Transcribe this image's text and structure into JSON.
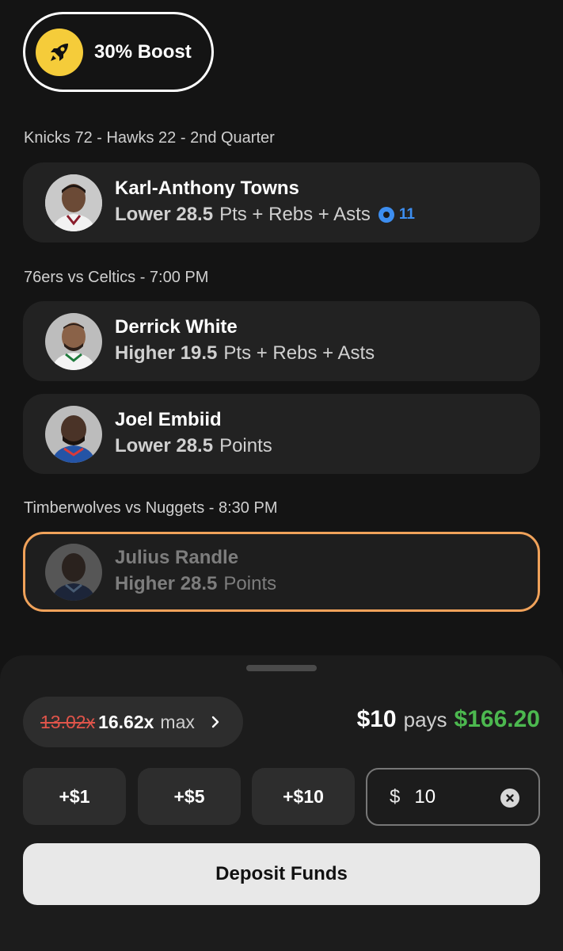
{
  "boost": {
    "label": "30% Boost",
    "icon": "rocket-icon",
    "color": "#f5cc3a"
  },
  "sections": [
    {
      "title": "Knicks 72 - Hawks 22 - 2nd Quarter"
    },
    {
      "title": "76ers vs Celtics - 7:00 PM"
    },
    {
      "title": "Timberwolves vs Nuggets - 8:30 PM"
    }
  ],
  "picks": [
    {
      "name": "Karl-Anthony Towns",
      "direction": "Lower",
      "line": "28.5",
      "stat": "Pts + Rebs + Asts",
      "live_count": "11"
    },
    {
      "name": "Derrick White",
      "direction": "Higher",
      "line": "19.5",
      "stat": "Pts + Rebs + Asts"
    },
    {
      "name": "Joel Embiid",
      "direction": "Lower",
      "line": "28.5",
      "stat": "Points"
    },
    {
      "name": "Julius Randle",
      "direction": "Higher",
      "line": "28.5",
      "stat": "Points"
    }
  ],
  "slip": {
    "old_multiplier": "13.02x",
    "new_multiplier": "16.62x",
    "max_label": "max",
    "entry_amount": "$10",
    "pays_label": "pays",
    "payout": "$166.20",
    "quick_adds": [
      "+$1",
      "+$5",
      "+$10"
    ],
    "currency_symbol": "$",
    "amount_value": "10",
    "deposit_label": "Deposit Funds"
  },
  "colors": {
    "accent_green": "#4cb84f",
    "strike_red": "#e0544a",
    "highlight_orange": "#f0a25a",
    "live_blue": "#3d8ef0"
  }
}
